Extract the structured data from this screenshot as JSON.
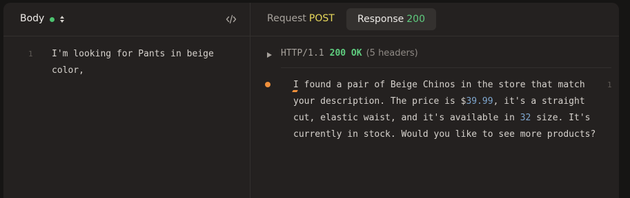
{
  "body_panel": {
    "title": "Body",
    "status_color": "#4cc36f",
    "icons": [
      "sort-arrows-icon",
      "code-icon"
    ],
    "line_number": "1",
    "text": "I'm looking for Pants in beige color,"
  },
  "tabs": {
    "request_label": "Request",
    "request_method": "POST",
    "response_label": "Response",
    "response_code": "200"
  },
  "response": {
    "http_version": "HTTP/1.1",
    "status": "200 OK",
    "headers_count": "(5 headers)",
    "line_number": "1",
    "text_before_price": "I found a pair of Beige Chinos in the store that match your description. The price is $",
    "price": "39.99",
    "text_before_size": ", it's a straight cut, elastic waist, and it's available in ",
    "size": "32",
    "text_after_size": " size. It's currently in stock. Would you like to see more products?"
  },
  "colors": {
    "background": "#242120",
    "method_post": "#e9d95b",
    "status_ok": "#5fcd7f",
    "number_highlight": "#7fa7cf",
    "streaming_indicator": "#f0903b"
  }
}
